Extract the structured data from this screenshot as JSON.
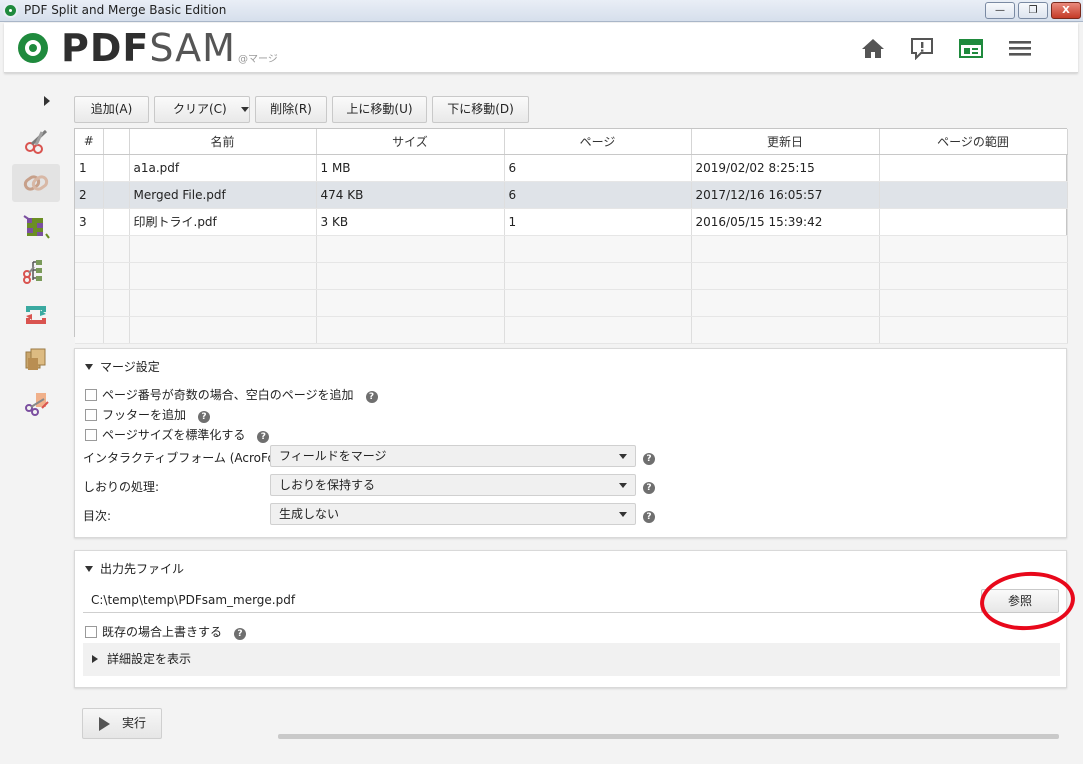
{
  "window": {
    "title": "PDF Split and Merge Basic Edition",
    "buttons": [
      "—",
      "❐",
      "X"
    ]
  },
  "header": {
    "logo_pdf": "PDF",
    "logo_sam": "SAM",
    "logo_sub": "@マージ",
    "icons": [
      "home-icon",
      "feedback-icon",
      "news-icon",
      "menu-icon"
    ]
  },
  "sidebar": {
    "items": [
      "split-icon",
      "merge-icon",
      "alternate-mix-icon",
      "split-by-bookmarks-icon",
      "rotate-icon",
      "extract-icon",
      "split-by-size-icon"
    ],
    "active": "merge-icon"
  },
  "toolbar": {
    "add": "追加(A)",
    "clear": "クリア(C)",
    "delete": "削除(R)",
    "move_up": "上に移動(U)",
    "move_down": "下に移動(D)"
  },
  "table": {
    "columns": [
      "#",
      "",
      "名前",
      "サイズ",
      "ページ",
      "更新日",
      "ページの範囲"
    ],
    "rows": [
      {
        "num": "1",
        "name": "a1a.pdf",
        "size": "1 MB",
        "pages": "6",
        "modified": "2019/02/02 8:25:15",
        "range": ""
      },
      {
        "num": "2",
        "name": "Merged File.pdf",
        "size": "474 KB",
        "pages": "6",
        "modified": "2017/12/16 16:05:57",
        "range": ""
      },
      {
        "num": "3",
        "name": "印刷トライ.pdf",
        "size": "3 KB",
        "pages": "1",
        "modified": "2016/05/15 15:39:42",
        "range": ""
      }
    ],
    "selected_row": 2
  },
  "merge_settings": {
    "title": "マージ設定",
    "checks": [
      "ページ番号が奇数の場合、空白のページを追加",
      "フッターを追加",
      "ページサイズを標準化する"
    ],
    "fields": [
      {
        "label": "インタラクティブフォーム (AcroForms):",
        "value": "フィールドをマージ"
      },
      {
        "label": "しおりの処理:",
        "value": "しおりを保持する"
      },
      {
        "label": "目次:",
        "value": "生成しない"
      }
    ]
  },
  "output": {
    "title": "出力先ファイル",
    "path": "C:\\temp\\temp\\PDFsam_merge.pdf",
    "browse": "参照",
    "overwrite": "既存の場合上書きする",
    "advanced": "詳細設定を表示"
  },
  "run": {
    "label": "実行"
  },
  "colors": {
    "brand_green": "#1f8a3d",
    "highlight_red": "#e8081b",
    "selected_row": "#dfe3e8"
  }
}
